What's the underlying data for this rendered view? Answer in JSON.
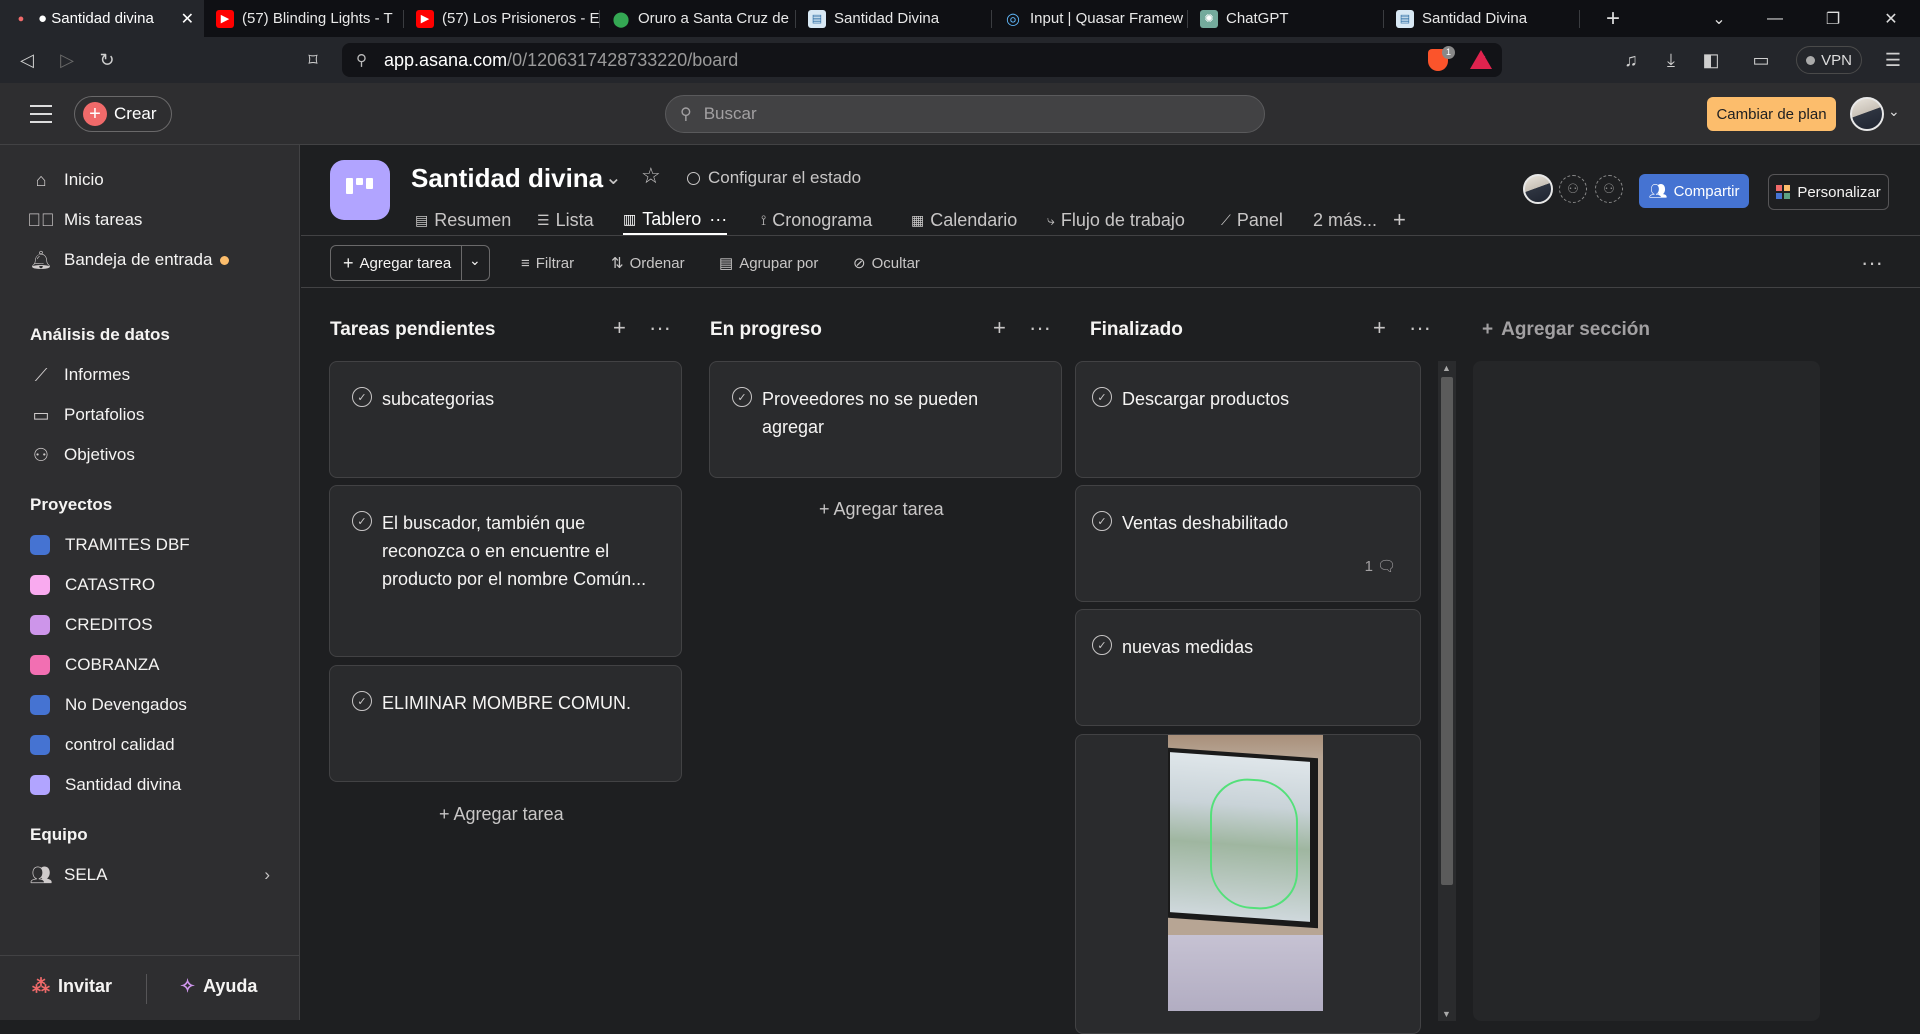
{
  "browser": {
    "tabs": [
      {
        "title": "● Santidad divina",
        "icon": "asana-icon",
        "active": true
      },
      {
        "title": "(57) Blinding Lights - T",
        "icon": "youtube-icon"
      },
      {
        "title": "(57) Los Prisioneros - E",
        "icon": "youtube-icon"
      },
      {
        "title": "Oruro a Santa Cruz de",
        "icon": "maps-pin-icon"
      },
      {
        "title": "Santidad Divina",
        "icon": "page-icon"
      },
      {
        "title": "Input | Quasar Framew",
        "icon": "quasar-icon"
      },
      {
        "title": "ChatGPT",
        "icon": "chatgpt-icon"
      },
      {
        "title": "Santidad Divina",
        "icon": "page-icon"
      }
    ],
    "url_host": "app.asana.com",
    "url_path": "/0/1206317428733220/board",
    "vpn_label": "VPN",
    "shield_badge": "1"
  },
  "topbar": {
    "create_label": "Crear",
    "search_placeholder": "Buscar",
    "upgrade_label": "Cambiar de plan"
  },
  "sidebar": {
    "nav": [
      {
        "label": "Inicio",
        "icon": "home-icon"
      },
      {
        "label": "Mis tareas",
        "icon": "check-circle-icon"
      },
      {
        "label": "Bandeja de entrada",
        "icon": "bell-icon"
      }
    ],
    "analysis_heading": "Análisis de datos",
    "analysis": [
      {
        "label": "Informes",
        "icon": "chart-line-icon"
      },
      {
        "label": "Portafolios",
        "icon": "folder-icon"
      },
      {
        "label": "Objetivos",
        "icon": "person-icon"
      }
    ],
    "projects_heading": "Proyectos",
    "projects": [
      {
        "label": "TRAMITES DBF",
        "color": "#4573d2"
      },
      {
        "label": "CATASTRO",
        "color": "#f9aaef"
      },
      {
        "label": "CREDITOS",
        "color": "#cd95ea"
      },
      {
        "label": "COBRANZA",
        "color": "#f26fb2"
      },
      {
        "label": "No Devengados",
        "color": "#4573d2"
      },
      {
        "label": "control calidad",
        "color": "#4573d2"
      },
      {
        "label": "Santidad divina",
        "color": "#b1a4ff"
      }
    ],
    "team_heading": "Equipo",
    "team": "SELA",
    "invite_label": "Invitar",
    "help_label": "Ayuda"
  },
  "project": {
    "title": "Santidad divina",
    "status_label": "Configurar el estado",
    "tabs": [
      {
        "label": "Resumen",
        "icon": "clipboard-icon"
      },
      {
        "label": "Lista",
        "icon": "list-icon"
      },
      {
        "label": "Tablero",
        "icon": "board-icon",
        "active": true
      },
      {
        "label": "Cronograma",
        "icon": "timeline-icon"
      },
      {
        "label": "Calendario",
        "icon": "calendar-icon"
      },
      {
        "label": "Flujo de trabajo",
        "icon": "workflow-icon"
      },
      {
        "label": "Panel",
        "icon": "dashboard-icon"
      },
      {
        "label": "2 más...",
        "icon": ""
      }
    ],
    "share_label": "Compartir",
    "customize_label": "Personalizar"
  },
  "toolbar": {
    "add_task_label": "Agregar tarea",
    "filter_label": "Filtrar",
    "sort_label": "Ordenar",
    "group_label": "Agrupar por",
    "hide_label": "Ocultar"
  },
  "board": {
    "add_section_label": "Agregar sección",
    "add_task_link": "Agregar tarea",
    "columns": [
      {
        "title": "Tareas pendientes",
        "cards": [
          {
            "title": "subcategorias"
          },
          {
            "title": "El buscador, también que reconozca o en encuentre el producto por el nombre Común..."
          },
          {
            "title": "ELIMINAR MOMBRE COMUN."
          }
        ]
      },
      {
        "title": "En progreso",
        "cards": [
          {
            "title": "Proveedores no se pueden agregar"
          }
        ]
      },
      {
        "title": "Finalizado",
        "cards": [
          {
            "title": "Descargar productos"
          },
          {
            "title": "Ventas deshabilitado",
            "comments": "1"
          },
          {
            "title": "nuevas medidas"
          }
        ]
      }
    ]
  }
}
